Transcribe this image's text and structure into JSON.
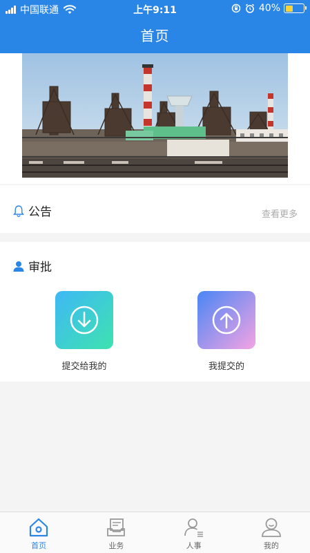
{
  "status_bar": {
    "carrier": "中国联通",
    "time": "上午9:11",
    "battery": "40%"
  },
  "nav": {
    "title": "首页"
  },
  "announcement": {
    "title": "公告",
    "more": "查看更多"
  },
  "approval": {
    "title": "审批",
    "items": [
      {
        "label": "提交给我的",
        "icon": "arrow-down-circle-icon"
      },
      {
        "label": "我提交的",
        "icon": "arrow-up-circle-icon"
      }
    ]
  },
  "tabbar": {
    "items": [
      {
        "label": "首页",
        "icon": "home-icon",
        "active": true
      },
      {
        "label": "业务",
        "icon": "business-icon",
        "active": false
      },
      {
        "label": "人事",
        "icon": "personnel-icon",
        "active": false
      },
      {
        "label": "我的",
        "icon": "profile-icon",
        "active": false
      }
    ]
  },
  "colors": {
    "primary": "#2a86e6",
    "battery": "#f7d33c",
    "approve_in_gradient": [
      "#3fb8f5",
      "#3de3b0"
    ],
    "approve_out_gradient": [
      "#4a86f5",
      "#f4a3e3"
    ]
  }
}
